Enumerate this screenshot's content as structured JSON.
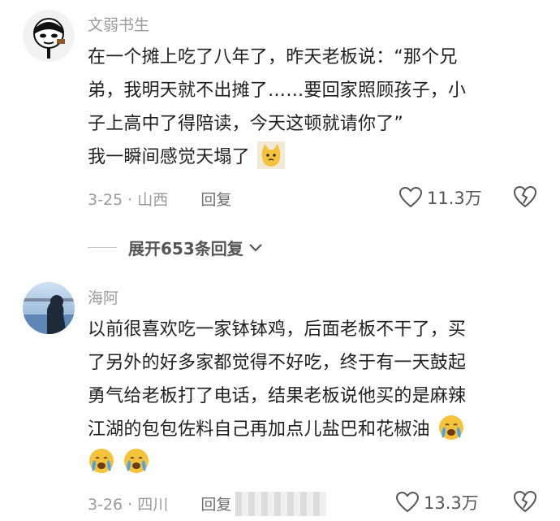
{
  "comments": [
    {
      "username": "文弱书生",
      "avatar_caption": "嗯，我很有耐心",
      "lines": [
        "在一个摊上吃了八年了，昨天老板说：“那个兄",
        "弟，我明天就不出摊了……要回家照顾孩子，小",
        "子上高中了得陪读，今天这顿就请你了”",
        "我一瞬间感觉天塌了"
      ],
      "emoji": "cat-emoji",
      "date": "3-25",
      "location": "山西",
      "reply_label": "回复",
      "likes": "11.3万"
    },
    {
      "username": "海阿",
      "lines": [
        "以前很喜欢吃一家钵钵鸡，后面老板不干了，买",
        "了另外的好多家都觉得不好吃，终于有一天鼓起",
        "勇气给老板打了电话，结果老板说他买的是麻辣",
        "江湖的包包佐料自己再加点儿盐巴和花椒油"
      ],
      "emoji": "crying-face-emoji",
      "date": "3-26",
      "location": "四川",
      "reply_label": "回复",
      "likes": "13.3万"
    }
  ],
  "expand_replies": "展开653条回复",
  "colors": {
    "text": "#1f1f1f",
    "meta": "#9a9a9a",
    "emoji_yellow": "#f5c23c",
    "tear_blue": "#4aa3e8"
  }
}
